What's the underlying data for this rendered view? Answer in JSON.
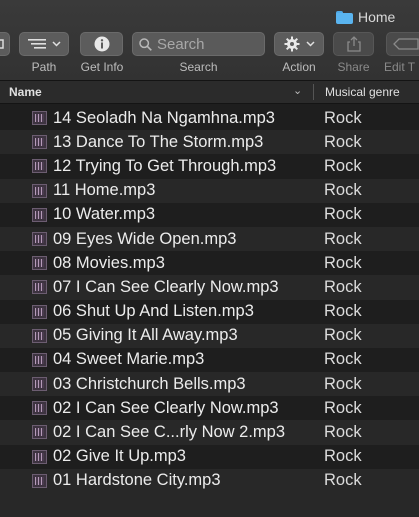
{
  "window": {
    "title": "Home"
  },
  "toolbar": {
    "path_label": "Path",
    "get_info_label": "Get Info",
    "search_label": "Search",
    "search_placeholder": "Search",
    "action_label": "Action",
    "share_label": "Share",
    "edit_label": "Edit T"
  },
  "columns": {
    "name": "Name",
    "genre": "Musical genre"
  },
  "files": [
    {
      "name": "14 Seoladh Na Ngamhna.mp3",
      "genre": "Rock"
    },
    {
      "name": "13 Dance To The Storm.mp3",
      "genre": "Rock"
    },
    {
      "name": "12 Trying To Get Through.mp3",
      "genre": "Rock"
    },
    {
      "name": "11 Home.mp3",
      "genre": "Rock"
    },
    {
      "name": "10 Water.mp3",
      "genre": "Rock"
    },
    {
      "name": "09 Eyes Wide Open.mp3",
      "genre": "Rock"
    },
    {
      "name": "08 Movies.mp3",
      "genre": "Rock"
    },
    {
      "name": "07 I Can See Clearly Now.mp3",
      "genre": "Rock"
    },
    {
      "name": "06 Shut Up And Listen.mp3",
      "genre": "Rock"
    },
    {
      "name": "05 Giving It All Away.mp3",
      "genre": "Rock"
    },
    {
      "name": "04 Sweet Marie.mp3",
      "genre": "Rock"
    },
    {
      "name": "03 Christchurch Bells.mp3",
      "genre": "Rock"
    },
    {
      "name": "02 I Can See Clearly Now.mp3",
      "genre": "Rock"
    },
    {
      "name": "02 I Can See C...rly Now 2.mp3",
      "genre": "Rock"
    },
    {
      "name": "02 Give It Up.mp3",
      "genre": "Rock"
    },
    {
      "name": "01 Hardstone City.mp3",
      "genre": "Rock"
    }
  ]
}
